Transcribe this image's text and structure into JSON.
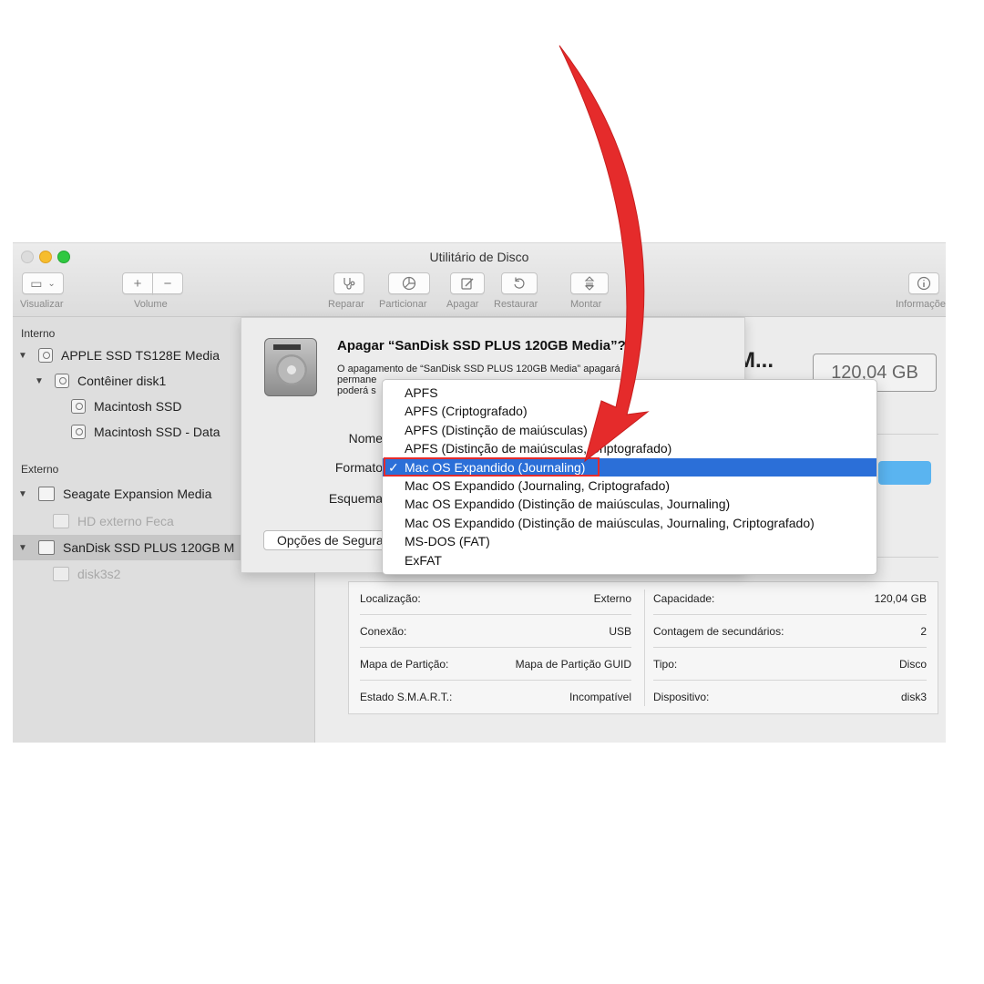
{
  "window": {
    "title": "Utilitário de Disco",
    "colors": {
      "accent": "#2b6fd8",
      "annotation": "#e52b2b"
    }
  },
  "toolbar": {
    "view_label": "Visualizar",
    "volume_label": "Volume",
    "add_symbol": "+",
    "remove_symbol": "−",
    "repair_label": "Reparar",
    "partition_label": "Particionar",
    "erase_label": "Apagar",
    "restore_label": "Restaurar",
    "mount_label": "Montar",
    "info_label": "Informações"
  },
  "sidebar": {
    "internal_header": "Interno",
    "external_header": "Externo",
    "items": [
      {
        "label": "APPLE SSD TS128E Media"
      },
      {
        "label": "Contêiner disk1"
      },
      {
        "label": "Macintosh SSD"
      },
      {
        "label": "Macintosh SSD - Data"
      },
      {
        "label": "Seagate Expansion Media"
      },
      {
        "label": "HD externo Feca"
      },
      {
        "label": "SanDisk SSD PLUS 120GB M"
      },
      {
        "label": "disk3s2"
      }
    ]
  },
  "main": {
    "title_partial": "M...",
    "capacity": "120,04 GB"
  },
  "info": {
    "rows": [
      {
        "left_label": "Localização:",
        "left_value": "Externo",
        "right_label": "Capacidade:",
        "right_value": "120,04 GB"
      },
      {
        "left_label": "Conexão:",
        "left_value": "USB",
        "right_label": "Contagem de secundários:",
        "right_value": "2"
      },
      {
        "left_label": "Mapa de Partição:",
        "left_value": "Mapa de Partição GUID",
        "right_label": "Tipo:",
        "right_value": "Disco"
      },
      {
        "left_label": "Estado S.M.A.R.T.:",
        "left_value": "Incompatível",
        "right_label": "Dispositivo:",
        "right_value": "disk3"
      }
    ]
  },
  "sheet": {
    "title": "Apagar “SanDisk SSD PLUS 120GB Media”?",
    "desc_line1": "O apagamento de “SanDisk SSD PLUS 120GB Media” apagará",
    "desc_line2": "permane",
    "desc_line3": "poderá s",
    "name_label": "Nome",
    "format_label": "Formato",
    "scheme_label": "Esquema",
    "options_button": "Opções de Segurança..."
  },
  "format_menu": {
    "selected_index": 4,
    "check_mark": "✓",
    "options": [
      "APFS",
      "APFS (Criptografado)",
      "APFS (Distinção de maiúsculas)",
      "APFS (Distinção de maiúsculas, Criptografado)",
      "Mac OS Expandido (Journaling)",
      "Mac OS Expandido (Journaling, Criptografado)",
      "Mac OS Expandido (Distinção de maiúsculas, Journaling)",
      "Mac OS Expandido (Distinção de maiúsculas, Journaling, Criptografado)",
      "MS-DOS (FAT)",
      "ExFAT"
    ]
  }
}
